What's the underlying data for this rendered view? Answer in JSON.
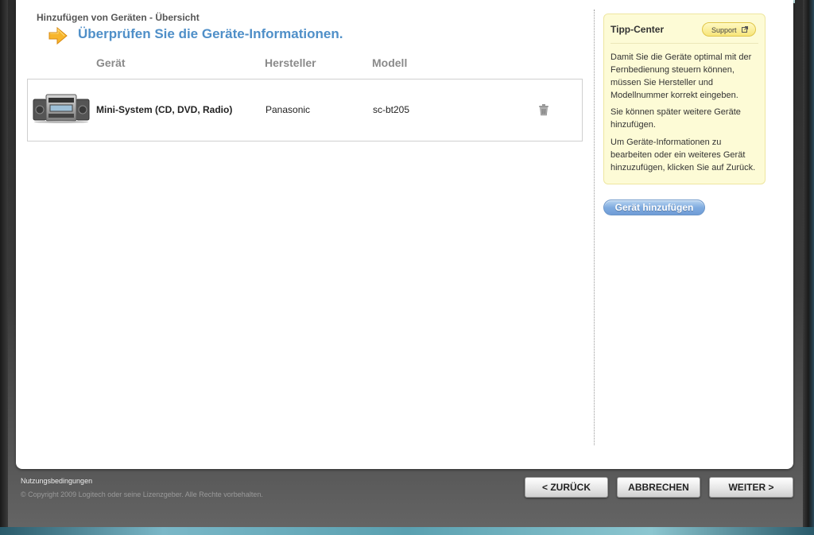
{
  "wizard": {
    "breadcrumb": "Hinzufügen von Geräten - Übersicht",
    "headline": "Überprüfen Sie die Geräte-Informationen."
  },
  "table": {
    "headers": {
      "device": "Gerät",
      "manufacturer": "Hersteller",
      "model": "Modell"
    },
    "rows": [
      {
        "name": "Mini-System (CD, DVD, Radio)",
        "manufacturer": "Panasonic",
        "model": "sc-bt205",
        "icon": "mini-system-image"
      }
    ]
  },
  "tips": {
    "title": "Tipp-Center",
    "support_label": "Support",
    "paragraphs": [
      "Damit Sie die Geräte optimal mit der Fernbedienung steuern können, müssen Sie Hersteller und Modellnummer korrekt eingeben.",
      "Sie können später weitere Geräte hinzufügen.",
      "Um Geräte-Informationen zu bearbeiten oder ein weiteres Gerät hinzuzufügen, klicken Sie auf Zurück."
    ]
  },
  "add_device_label": "Gerät hinzufügen",
  "footer": {
    "terms": "Nutzungsbedingungen",
    "copyright": "© Copyright 2009 Logitech oder seine Lizenzgeber. Alle Rechte vorbehalten.",
    "back": "< ZURÜCK",
    "cancel": "ABBRECHEN",
    "next": "WEITER >"
  },
  "colors": {
    "headline": "#4f8fc8",
    "tip_background": "#fdfbd6",
    "add_button": "#80ace0"
  }
}
